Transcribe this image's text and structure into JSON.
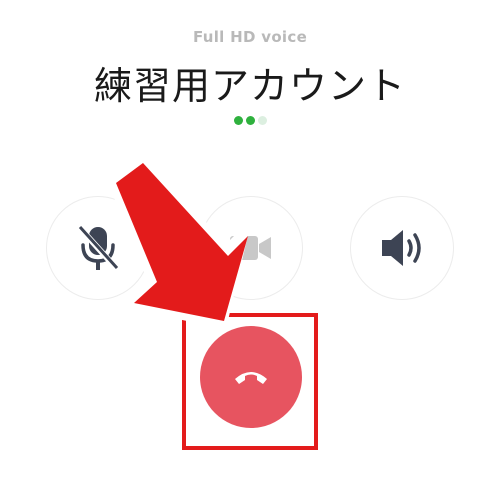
{
  "call": {
    "quality_label": "Full HD voice",
    "contact_name": "練習用アカウント"
  },
  "controls": {
    "mute": {
      "icon": "microphone-off-icon",
      "state": "muted"
    },
    "video": {
      "icon": "video-camera-icon",
      "state": "disabled"
    },
    "speaker": {
      "icon": "speaker-icon",
      "state": "enabled"
    },
    "end_call": {
      "icon": "phone-hangup-icon"
    }
  },
  "colors": {
    "accent_green": "#2fb13e",
    "end_call_red": "#e75460",
    "annotation_red": "#e31b1b",
    "icon_gray": "#3d4454",
    "disabled_gray": "#c8c8c8"
  },
  "indicator": {
    "active_dots": 2,
    "total_dots": 3
  }
}
